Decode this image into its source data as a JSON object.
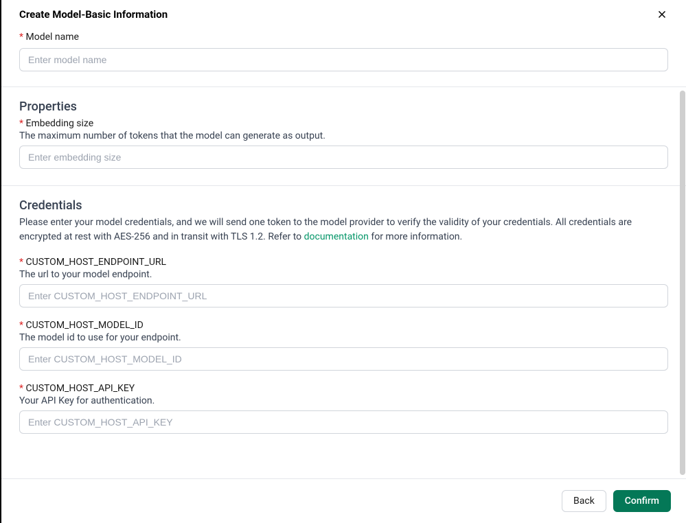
{
  "header": {
    "title": "Create Model-Basic Information"
  },
  "basic": {
    "model_name_label": "Model name",
    "model_name_placeholder": "Enter model name"
  },
  "properties": {
    "title": "Properties",
    "embedding_size_label": "Embedding size",
    "embedding_size_help": "The maximum number of tokens that the model can generate as output.",
    "embedding_size_placeholder": "Enter embedding size"
  },
  "credentials": {
    "title": "Credentials",
    "desc_prefix": "Please enter your model credentials, and we will send one token to the model provider to verify the validity of your credentials. All credentials are encrypted at rest with AES-256 and in transit with TLS 1.2. Refer to ",
    "link_text": "documentation",
    "desc_suffix": " for more information.",
    "fields": [
      {
        "label": "CUSTOM_HOST_ENDPOINT_URL",
        "help": "The url to your model endpoint.",
        "placeholder": "Enter CUSTOM_HOST_ENDPOINT_URL"
      },
      {
        "label": "CUSTOM_HOST_MODEL_ID",
        "help": "The model id to use for your endpoint.",
        "placeholder": "Enter CUSTOM_HOST_MODEL_ID"
      },
      {
        "label": "CUSTOM_HOST_API_KEY",
        "help": "Your API Key for authentication.",
        "placeholder": "Enter CUSTOM_HOST_API_KEY"
      }
    ]
  },
  "footer": {
    "back_label": "Back",
    "confirm_label": "Confirm"
  }
}
